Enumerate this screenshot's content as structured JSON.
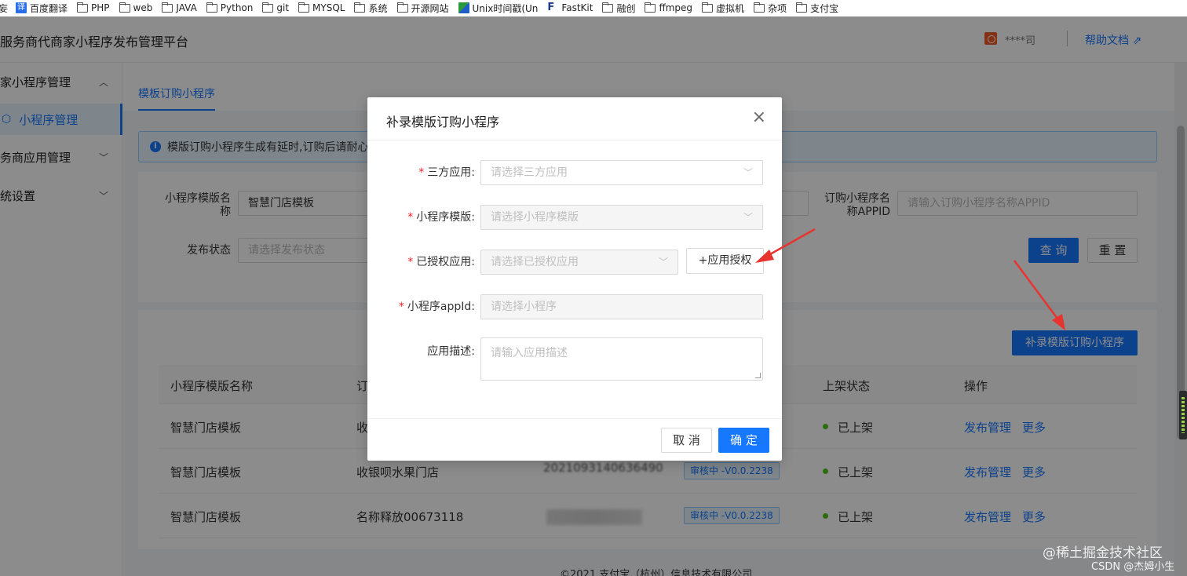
{
  "bookmarks": [
    {
      "label": "妄",
      "icon": "none"
    },
    {
      "label": "百度翻译",
      "icon": "translate-icon"
    },
    {
      "label": "PHP",
      "icon": "folder-icon"
    },
    {
      "label": "web",
      "icon": "folder-icon"
    },
    {
      "label": "JAVA",
      "icon": "folder-icon"
    },
    {
      "label": "Python",
      "icon": "folder-icon"
    },
    {
      "label": "git",
      "icon": "folder-icon"
    },
    {
      "label": "MYSQL",
      "icon": "folder-icon"
    },
    {
      "label": "系统",
      "icon": "folder-icon"
    },
    {
      "label": "开源网站",
      "icon": "folder-icon"
    },
    {
      "label": "Unix时间戳(Un",
      "icon": "unix-icon"
    },
    {
      "label": "FastKit",
      "icon": "fastkit-icon"
    },
    {
      "label": "融创",
      "icon": "folder-icon"
    },
    {
      "label": "ffmpeg",
      "icon": "folder-icon"
    },
    {
      "label": "虚拟机",
      "icon": "folder-icon"
    },
    {
      "label": "杂项",
      "icon": "folder-icon"
    },
    {
      "label": "支付宝",
      "icon": "folder-icon"
    }
  ],
  "header": {
    "title": "服务商代商家小程序发布管理平台",
    "company": "****司",
    "help": "帮助文档 ⇗"
  },
  "sidebar": {
    "items": [
      {
        "label": "家小程序管理",
        "chevron": "^"
      },
      {
        "label": "小程序管理",
        "active": true
      },
      {
        "label": "务商应用管理",
        "chevron": "⌄"
      },
      {
        "label": "统设置",
        "chevron": "⌄"
      }
    ]
  },
  "tabs": {
    "active": "模板订购小程序"
  },
  "alert": {
    "text": "模版订购小程序生成有延时,订购后请耐心"
  },
  "filters": {
    "template_name_label": "小程序模版名称",
    "template_name_value": "智慧门店模板",
    "appid_label": "订购小程序名称APPID",
    "appid_placeholder": "请输入订购小程序名称APPID",
    "status_label": "发布状态",
    "status_placeholder": "请选择发布状态",
    "query_button": "查 询",
    "reset_button": "重 置"
  },
  "table": {
    "add_button": "补录模版订购小程序",
    "columns": [
      "小程序模版名称",
      "订",
      "上架状态",
      "操作"
    ],
    "rows": [
      {
        "template": "智慧门店模板",
        "name": "收",
        "tag": "",
        "status": "已上架",
        "action1": "发布管理",
        "action2": "更多"
      },
      {
        "template": "智慧门店模板",
        "name": "收银呗水果门店",
        "id": "2021093140636490",
        "tag": "审核中 -V0.0.2238",
        "status": "已上架",
        "action1": "发布管理",
        "action2": "更多"
      },
      {
        "template": "智慧门店模板",
        "name": "名称释放00673118",
        "tag": "审核中 -V0.0.2238",
        "status": "已上架",
        "action1": "发布管理",
        "action2": "更多"
      }
    ]
  },
  "footer": {
    "text": "©2021 支付宝（杭州）信息技术有限公司"
  },
  "modal": {
    "title": "补录模版订购小程序",
    "close": "×",
    "fields": {
      "third_party": {
        "label": "三方应用:",
        "placeholder": "请选择三方应用"
      },
      "template": {
        "label": "小程序模版:",
        "placeholder": "请选择小程序模版"
      },
      "authorized": {
        "label": "已授权应用:",
        "placeholder": "请选择已授权应用"
      },
      "appid": {
        "label": "小程序appId:",
        "placeholder": "请选择小程序"
      },
      "desc": {
        "label": "应用描述:",
        "placeholder": "请输入应用描述"
      }
    },
    "auth_button": "+应用授权",
    "cancel": "取 消",
    "ok": "确 定"
  },
  "watermark": {
    "line1": "@稀土掘金技术社区",
    "line2": "CSDN @杰姆小生"
  },
  "colors": {
    "primary": "#1677ff",
    "required": "#f5222d",
    "success": "#52c41a",
    "arrow": "#e8342f"
  }
}
